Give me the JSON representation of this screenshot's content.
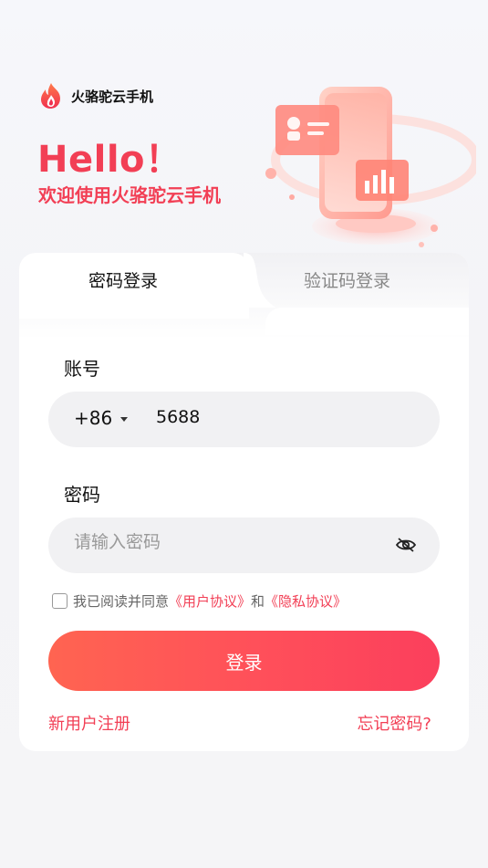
{
  "brand": {
    "name": "火骆驼云手机",
    "logo_icon": "flame-logo-icon"
  },
  "hero": {
    "title": "Hello！",
    "subtitle": "欢迎使用火骆驼云手机"
  },
  "tabs": [
    {
      "label": "密码登录",
      "active": true
    },
    {
      "label": "验证码登录",
      "active": false
    }
  ],
  "account": {
    "label": "账号",
    "country_code": "+86",
    "value": "5688"
  },
  "password": {
    "label": "密码",
    "placeholder": "请输入密码",
    "toggle_icon": "eye-hidden-icon"
  },
  "agreement": {
    "prefix": "我已阅读并同意",
    "user_agreement": "《用户协议》",
    "conjunction": "和",
    "privacy_policy": "《隐私协议》",
    "checked": false
  },
  "login_button": "登录",
  "footer": {
    "register": "新用户注册",
    "forgot": "忘记密码?"
  },
  "colors": {
    "accent": "#f23f55",
    "button_start": "#ff6451",
    "button_end": "#fb3f5c"
  }
}
